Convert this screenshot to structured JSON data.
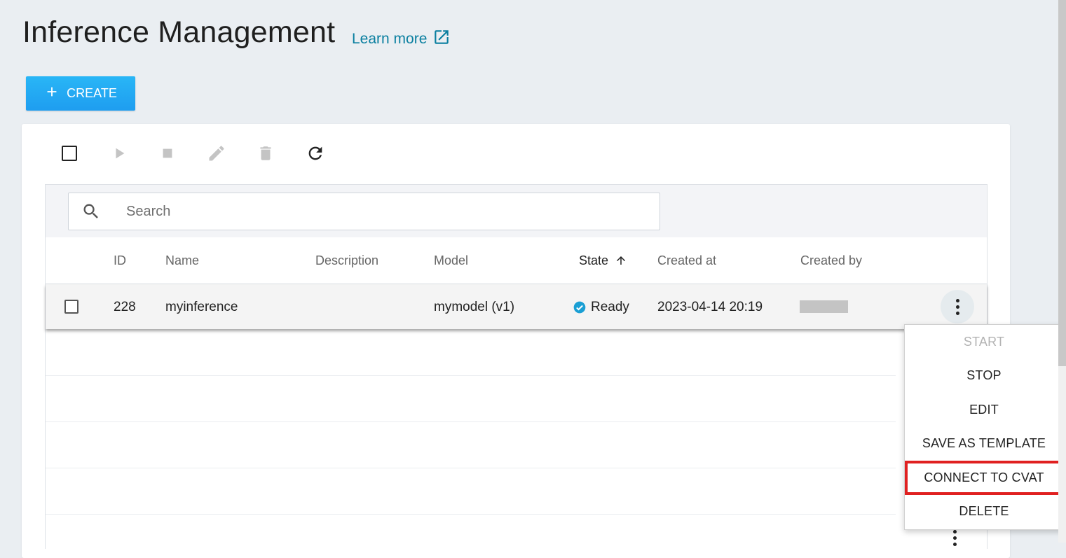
{
  "page": {
    "title": "Inference Management",
    "learn_more": "Learn more"
  },
  "toolbar": {
    "create_label": "CREATE"
  },
  "search": {
    "placeholder": "Search",
    "value": ""
  },
  "table": {
    "columns": [
      "ID",
      "Name",
      "Description",
      "Model",
      "State",
      "Created at",
      "Created by"
    ],
    "sort_column": "State",
    "sort_direction": "ascending",
    "rows": [
      {
        "id": "228",
        "name": "myinference",
        "description": "",
        "model": "mymodel (v1)",
        "state": "Ready",
        "created_at": "2023-04-14 20:19",
        "created_by": ""
      }
    ]
  },
  "context_menu": {
    "items": [
      {
        "label": "START",
        "disabled": true
      },
      {
        "label": "STOP",
        "disabled": false
      },
      {
        "label": "EDIT",
        "disabled": false
      },
      {
        "label": "SAVE AS TEMPLATE",
        "disabled": false
      },
      {
        "label": "CONNECT TO CVAT",
        "disabled": false,
        "highlighted": true
      },
      {
        "label": "DELETE",
        "disabled": false
      }
    ]
  },
  "colors": {
    "accent": "#1e9df0",
    "link": "#0a7fa0",
    "ready": "#1a9fd4",
    "highlight_border": "#e02020"
  }
}
